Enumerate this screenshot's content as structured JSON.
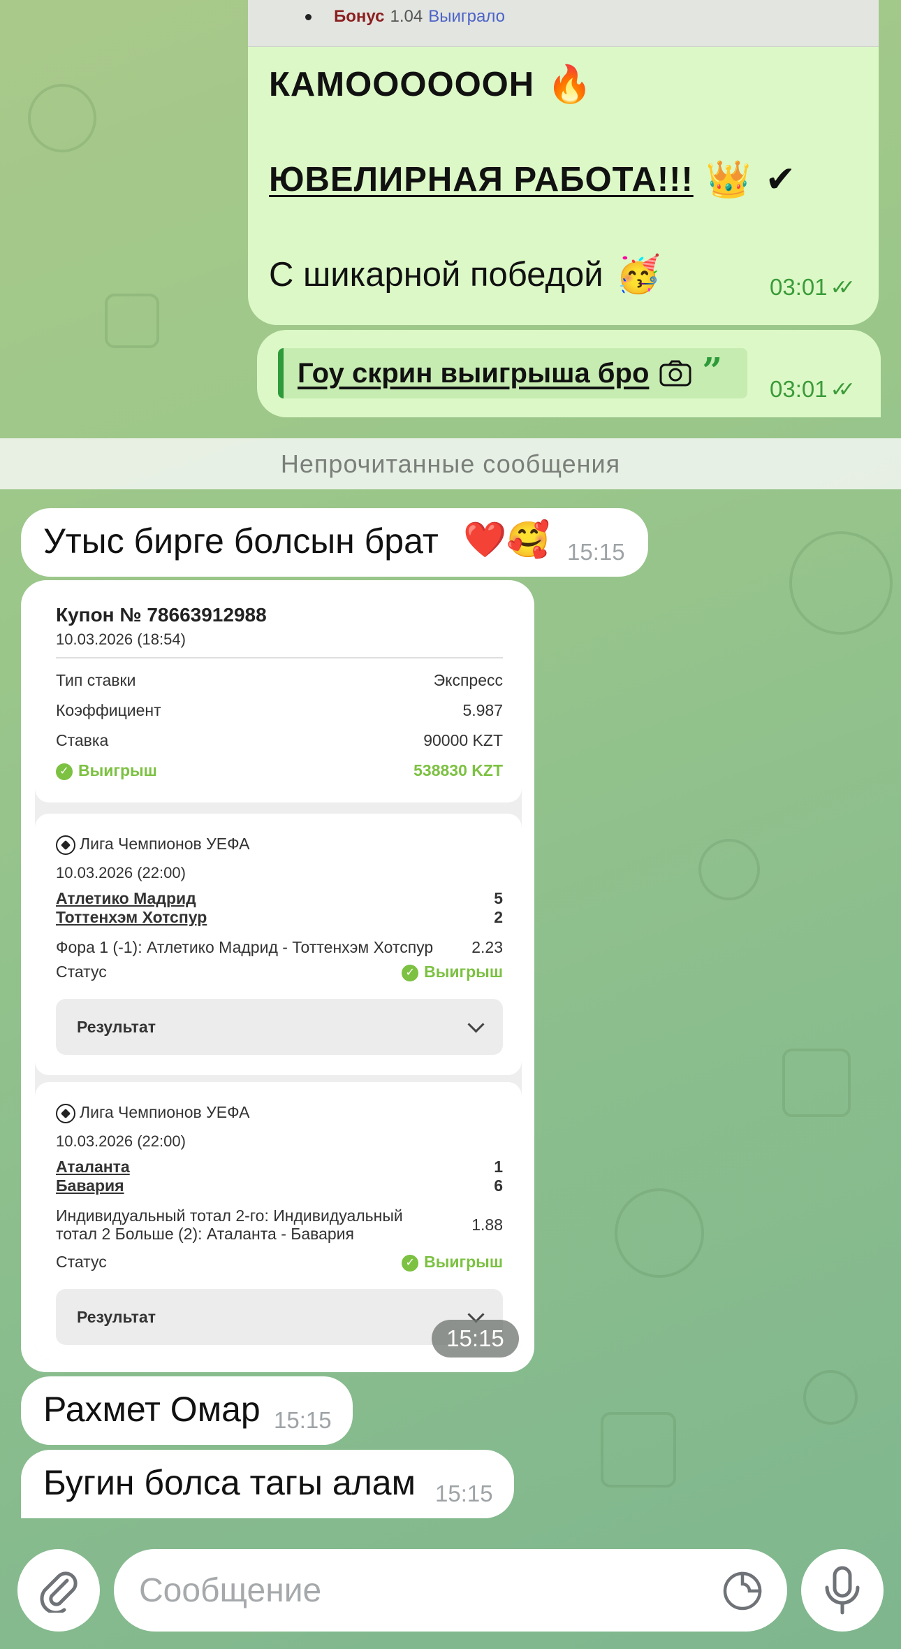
{
  "messages": {
    "quoted": {
      "bonus_label": "Бонус",
      "bonus_value": "1.04",
      "result": "Выиграло"
    },
    "out1": {
      "line1": "КАМООООООН",
      "line1_emoji": "🔥",
      "line2": "ЮВЕЛИРНАЯ РАБОТА!!!",
      "line2_emojis": "👑 ✔",
      "line3": "С шикарной победой",
      "line3_emoji": "🥳",
      "time": "03:01",
      "ticks": "✓✓"
    },
    "out2": {
      "reply_text": "Гоу скрин выигрыша бро",
      "quote_mark": "”",
      "time": "03:01",
      "ticks": "✓✓"
    },
    "unread_label": "Непрочитанные сообщения",
    "in1": {
      "text": "Утыс бирге болсын брат",
      "emojis": "❤️🥰",
      "time": "15:15"
    },
    "in3": {
      "text": "Рахмет Омар",
      "time": "15:15"
    },
    "in4": {
      "text": "Бугин болса тагы алам",
      "time": "15:15"
    },
    "card_time": "15:15"
  },
  "coupon": {
    "title": "Купон № 78663912988",
    "date": "10.03.2026 (18:54)",
    "rows": [
      {
        "label": "Тип ставки",
        "value": "Экспресс"
      },
      {
        "label": "Коэффициент",
        "value": "5.987"
      },
      {
        "label": "Ставка",
        "value": "90000 KZT"
      }
    ],
    "win_label": "Выигрыш",
    "win_value": "538830 KZT"
  },
  "events": [
    {
      "league": "Лига Чемпионов УЕФА",
      "date": "10.03.2026 (22:00)",
      "team1": "Атлетико Мадрид",
      "score1": "5",
      "team2": "Тоттенхэм Хотспур",
      "score2": "2",
      "bet": "Фора 1 (-1): Атлетико Мадрид - Тоттенхэм Хотспур",
      "odds": "2.23",
      "status_label": "Статус",
      "status_value": "Выигрыш",
      "result_label": "Результат"
    },
    {
      "league": "Лига Чемпионов УЕФА",
      "date": "10.03.2026 (22:00)",
      "team1": "Аталанта",
      "score1": "1",
      "team2": "Бавария",
      "score2": "6",
      "bet_line1": "Индивидуальный тотал 2-го: Индивидуальный",
      "bet_line2": "тотал 2 Больше (2): Аталанта - Бавария",
      "odds": "1.88",
      "status_label": "Статус",
      "status_value": "Выигрыш",
      "result_label": "Результат"
    }
  ],
  "input": {
    "placeholder": "Сообщение"
  },
  "icons": {
    "attach": "paperclip-icon",
    "sticker": "sticker-icon",
    "mic": "microphone-icon"
  }
}
